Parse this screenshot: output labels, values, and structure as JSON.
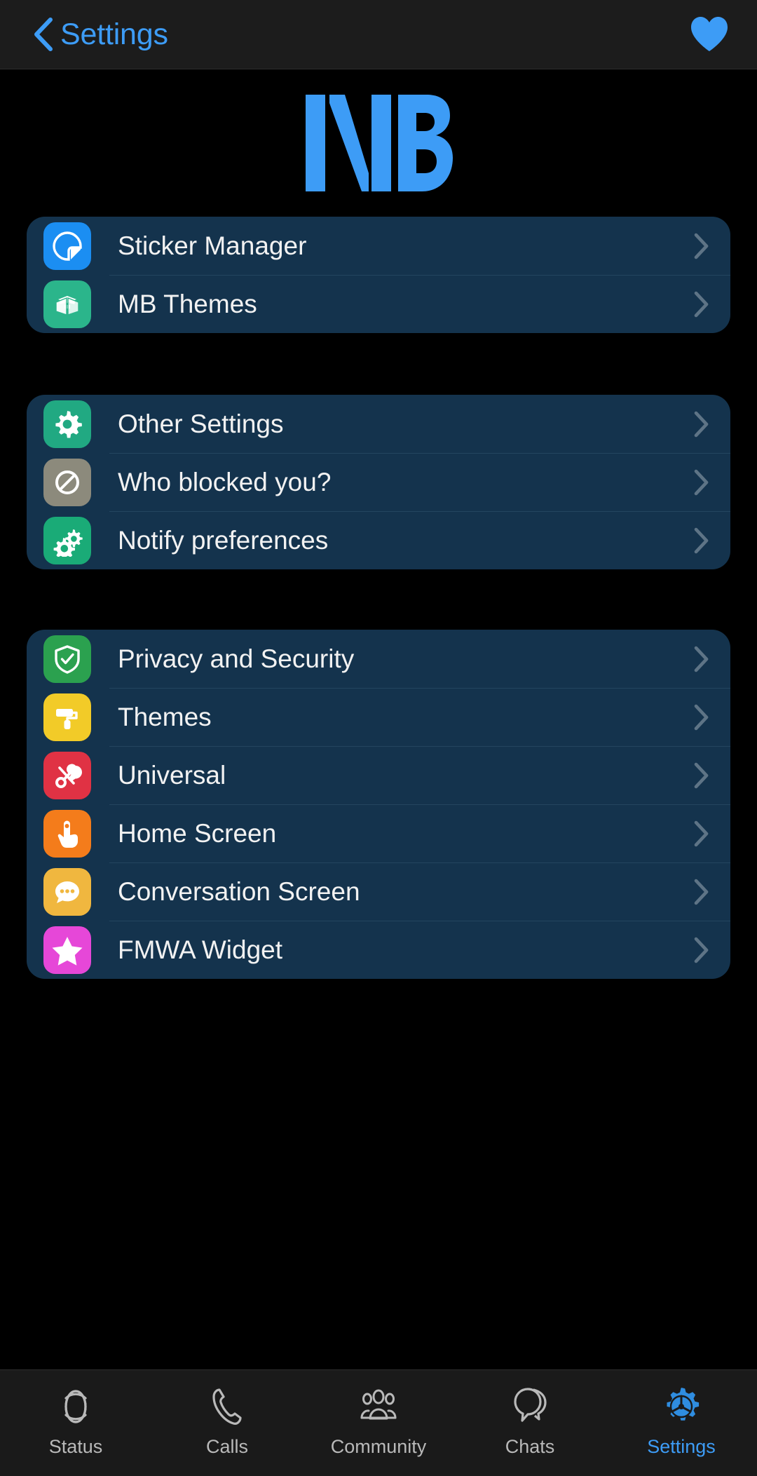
{
  "header": {
    "back_icon": "chevron-left-icon",
    "title": "Settings",
    "action_icon": "heart-icon",
    "accent_color": "#3d9cf6"
  },
  "logo": {
    "text": "MB",
    "color": "#3d9cf6"
  },
  "groups": [
    {
      "id": "group-modules",
      "rows": [
        {
          "label": "Sticker Manager",
          "icon": "sticker-icon",
          "icon_color": "#1b8ef2"
        },
        {
          "label": "MB Themes",
          "icon": "package-icon",
          "icon_color": "#2bb58b"
        }
      ]
    },
    {
      "id": "group-settings",
      "rows": [
        {
          "label": "Other Settings",
          "icon": "gear-icon",
          "icon_color": "#21a982"
        },
        {
          "label": "Who blocked you?",
          "icon": "block-icon",
          "icon_color": "#8c8a7c"
        },
        {
          "label": "Notify preferences",
          "icon": "double-gear-icon",
          "icon_color": "#1aab77"
        }
      ]
    },
    {
      "id": "group-appearance",
      "rows": [
        {
          "label": "Privacy and Security",
          "icon": "shield-check-icon",
          "icon_color": "#2ba14f"
        },
        {
          "label": "Themes",
          "icon": "paint-roller-icon",
          "icon_color": "#f2cb28"
        },
        {
          "label": "Universal",
          "icon": "tools-icon",
          "icon_color": "#e03244"
        },
        {
          "label": "Home Screen",
          "icon": "tap-hand-icon",
          "icon_color": "#f47c1b"
        },
        {
          "label": "Conversation Screen",
          "icon": "chat-bubble-icon",
          "icon_color": "#f0b73f"
        },
        {
          "label": "FMWA Widget",
          "icon": "star-icon",
          "icon_color": "#e647d8"
        }
      ]
    }
  ],
  "tabs": [
    {
      "label": "Status",
      "icon": "status-ring-icon",
      "active": false
    },
    {
      "label": "Calls",
      "icon": "phone-icon",
      "active": false
    },
    {
      "label": "Community",
      "icon": "community-icon",
      "active": false
    },
    {
      "label": "Chats",
      "icon": "chats-icon",
      "active": false
    },
    {
      "label": "Settings",
      "icon": "gear-active-icon",
      "active": true
    }
  ],
  "chevron_color": "#7b8d9c"
}
